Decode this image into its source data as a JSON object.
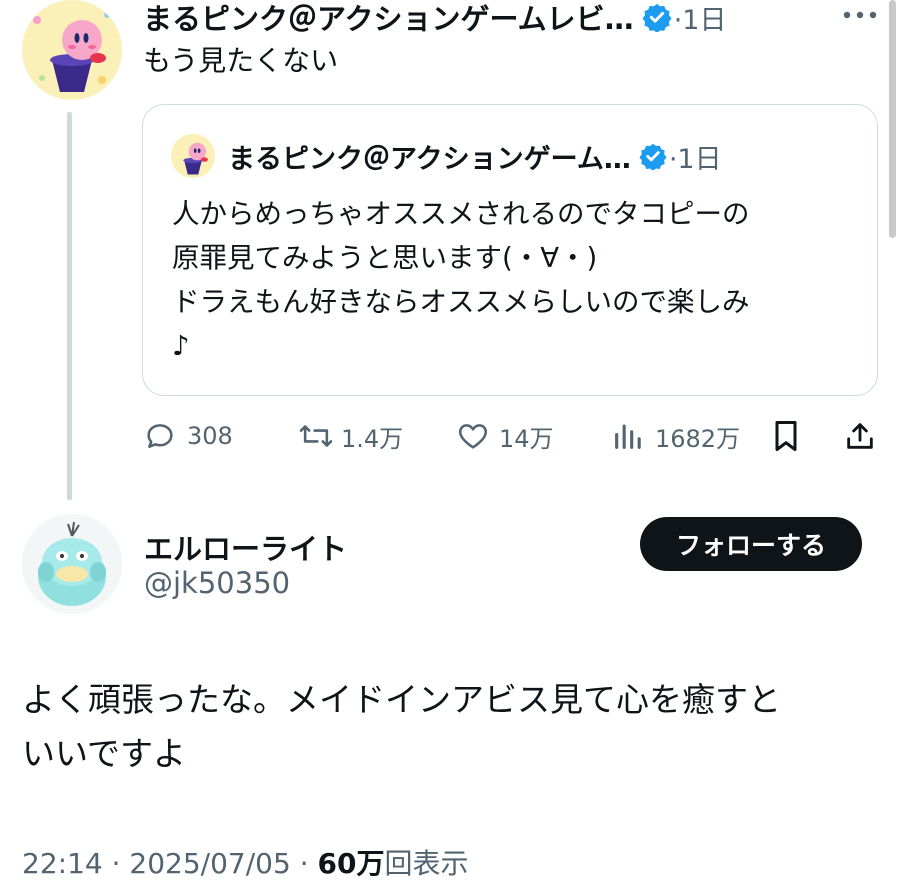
{
  "parent_tweet": {
    "author_name": "まるピンク＠アクションゲームレビ…",
    "time": "·1日",
    "text": "もう見たくない",
    "quote": {
      "author_name": "まるピンク＠アクションゲーム…",
      "time": "·1日",
      "text": "人からめっちゃオススメされるのでタコピーの\n原罪見てみようと思います(・∀・)\nドラえもん好きならオススメらしいので楽しみ\n♪"
    },
    "actions": {
      "replies": "308",
      "retweets": "1.4万",
      "likes": "14万",
      "views": "1682万"
    }
  },
  "reply_tweet": {
    "author_name": "エルローライト",
    "handle": "@jk50350",
    "follow_label": "フォローする",
    "text": "よく頑張ったな。メイドインアビス見て心を癒すと\nいいですよ",
    "meta": {
      "time": "22:14",
      "date": "2025/07/05",
      "views_count": "60万",
      "views_label": "回表示",
      "separator": " · "
    }
  },
  "colors": {
    "text": "#0f1419",
    "secondary": "#536471",
    "verified": "#1d9bf0",
    "border": "#cfd9de"
  }
}
